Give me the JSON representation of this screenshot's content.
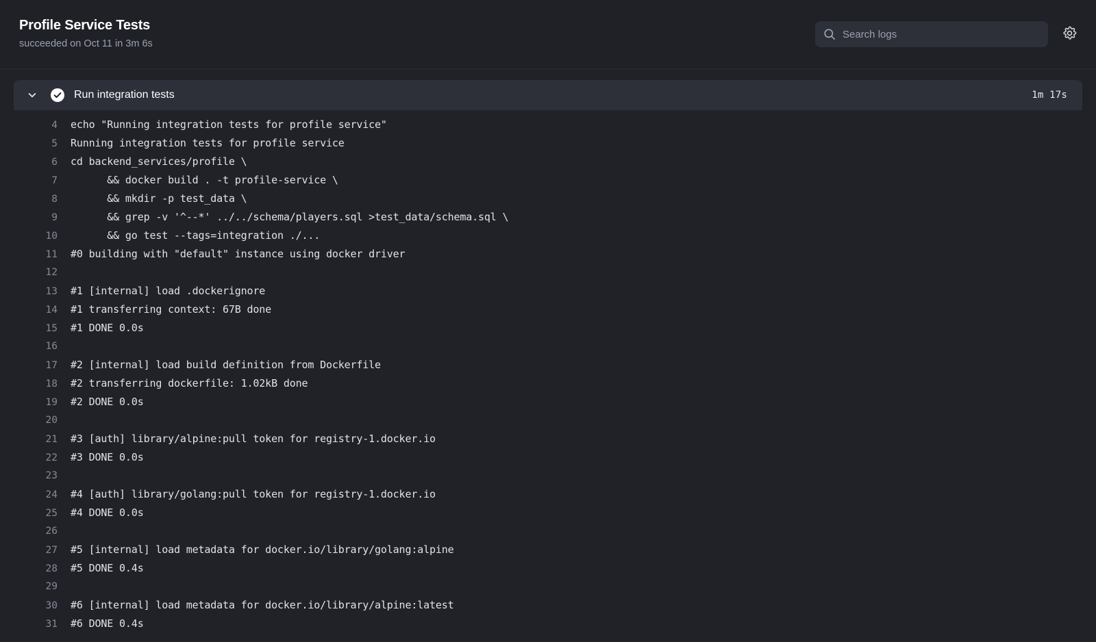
{
  "header": {
    "title": "Profile Service Tests",
    "subtitle": "succeeded on Oct 11 in 3m 6s",
    "search": {
      "placeholder": "Search logs",
      "value": "",
      "icon": "search-icon"
    },
    "settings": {
      "icon": "gear-icon",
      "label": "Settings"
    }
  },
  "step": {
    "title": "Run integration tests",
    "duration": "1m 17s",
    "status": "succeeded",
    "status_icon": "check-circle-icon",
    "expanded": true,
    "toggle_icon": "chevron-down-icon"
  },
  "colors": {
    "page_background": "#202228",
    "header_background": "#1f2127",
    "step_header_background": "#2d3039",
    "search_background": "#2d3039",
    "text_primary": "#ffffff",
    "text_secondary": "#9aa1ae",
    "log_text": "#dfe3ea",
    "line_number": "#848b98",
    "status_success": "#ffffff"
  },
  "log": {
    "lines": [
      {
        "n": "4",
        "text": "echo \"Running integration tests for profile service\""
      },
      {
        "n": "5",
        "text": "Running integration tests for profile service"
      },
      {
        "n": "6",
        "text": "cd backend_services/profile \\"
      },
      {
        "n": "7",
        "text": "      && docker build . -t profile-service \\"
      },
      {
        "n": "8",
        "text": "      && mkdir -p test_data \\"
      },
      {
        "n": "9",
        "text": "      && grep -v '^--*' ../../schema/players.sql >test_data/schema.sql \\"
      },
      {
        "n": "10",
        "text": "      && go test --tags=integration ./..."
      },
      {
        "n": "11",
        "text": "#0 building with \"default\" instance using docker driver"
      },
      {
        "n": "12",
        "text": ""
      },
      {
        "n": "13",
        "text": "#1 [internal] load .dockerignore"
      },
      {
        "n": "14",
        "text": "#1 transferring context: 67B done"
      },
      {
        "n": "15",
        "text": "#1 DONE 0.0s"
      },
      {
        "n": "16",
        "text": ""
      },
      {
        "n": "17",
        "text": "#2 [internal] load build definition from Dockerfile"
      },
      {
        "n": "18",
        "text": "#2 transferring dockerfile: 1.02kB done"
      },
      {
        "n": "19",
        "text": "#2 DONE 0.0s"
      },
      {
        "n": "20",
        "text": ""
      },
      {
        "n": "21",
        "text": "#3 [auth] library/alpine:pull token for registry-1.docker.io"
      },
      {
        "n": "22",
        "text": "#3 DONE 0.0s"
      },
      {
        "n": "23",
        "text": ""
      },
      {
        "n": "24",
        "text": "#4 [auth] library/golang:pull token for registry-1.docker.io"
      },
      {
        "n": "25",
        "text": "#4 DONE 0.0s"
      },
      {
        "n": "26",
        "text": ""
      },
      {
        "n": "27",
        "text": "#5 [internal] load metadata for docker.io/library/golang:alpine"
      },
      {
        "n": "28",
        "text": "#5 DONE 0.4s"
      },
      {
        "n": "29",
        "text": ""
      },
      {
        "n": "30",
        "text": "#6 [internal] load metadata for docker.io/library/alpine:latest"
      },
      {
        "n": "31",
        "text": "#6 DONE 0.4s"
      }
    ]
  }
}
